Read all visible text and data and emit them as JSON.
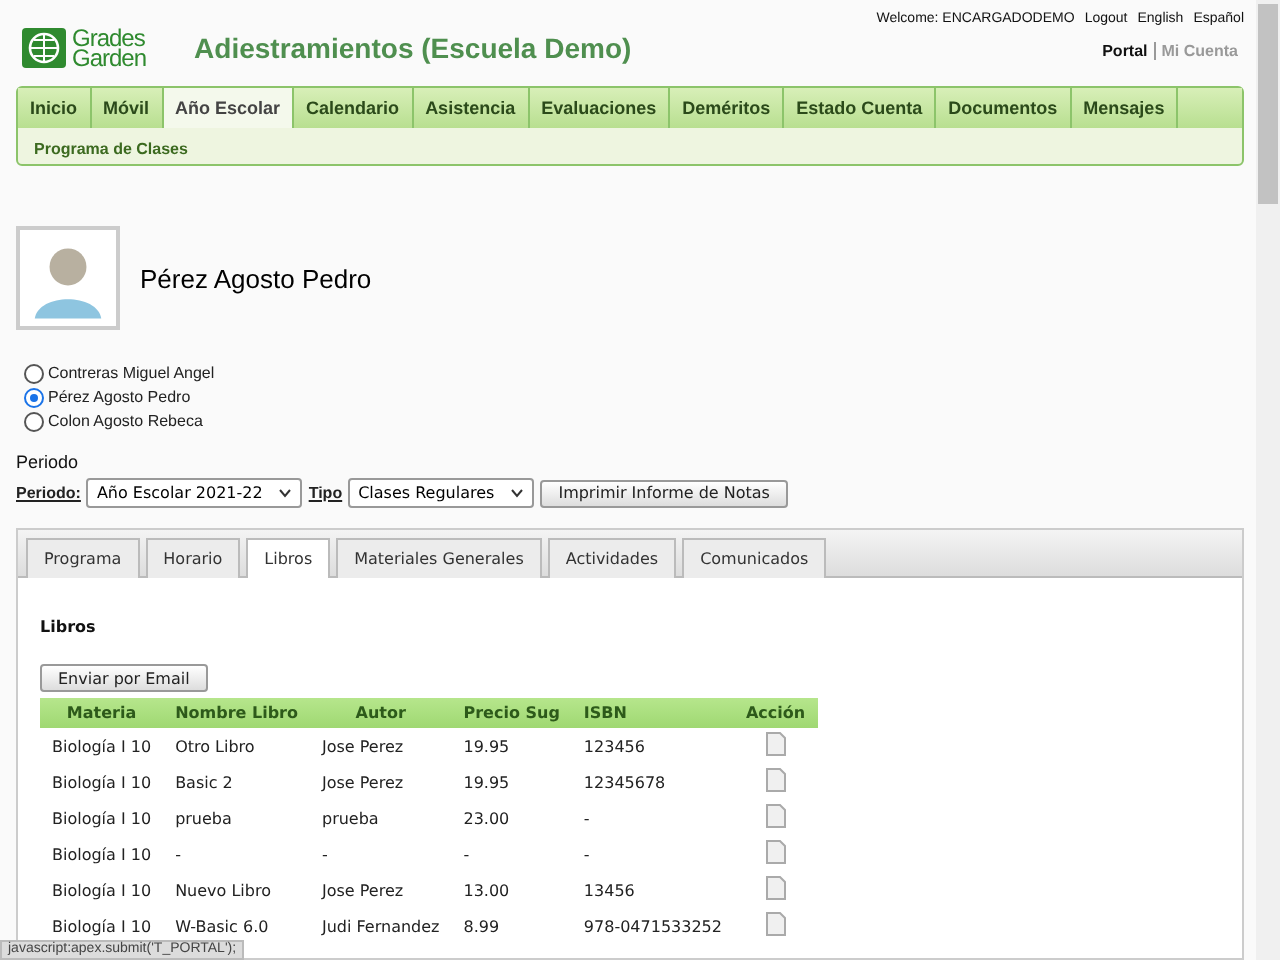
{
  "header": {
    "logo_top": "Grades",
    "logo_bottom": "Garden",
    "title": "Adiestramientos (Escuela Demo)",
    "welcome": "Welcome: ENCARGADODEMO",
    "links": [
      "Logout",
      "English",
      "Español"
    ],
    "portal_links": [
      {
        "label": "Portal",
        "selected": true
      },
      {
        "label": "Mi Cuenta",
        "selected": false
      }
    ]
  },
  "nav": {
    "tabs": [
      {
        "label": "Inicio",
        "selected": false
      },
      {
        "label": "Móvil",
        "selected": false
      },
      {
        "label": "Año Escolar",
        "selected": true
      },
      {
        "label": "Calendario",
        "selected": false
      },
      {
        "label": "Asistencia",
        "selected": false
      },
      {
        "label": "Evaluaciones",
        "selected": false
      },
      {
        "label": "Deméritos",
        "selected": false
      },
      {
        "label": "Estado Cuenta",
        "selected": false
      },
      {
        "label": "Documentos",
        "selected": false
      },
      {
        "label": "Mensajes",
        "selected": false
      }
    ],
    "subnav": [
      "Programa de Clases"
    ]
  },
  "student": {
    "name": "Pérez Agosto Pedro"
  },
  "students": [
    {
      "label": "Contreras Miguel Angel",
      "selected": false
    },
    {
      "label": "Pérez Agosto Pedro",
      "selected": true
    },
    {
      "label": "Colon Agosto Rebeca",
      "selected": false
    }
  ],
  "filters": {
    "heading": "Periodo",
    "period_label": "Periodo:",
    "period_value": "Año Escolar 2021-22",
    "type_label": "Tipo",
    "type_value": "Clases Regulares",
    "print_button": "Imprimir Informe de Notas"
  },
  "tabs": [
    {
      "label": "Programa",
      "selected": false
    },
    {
      "label": "Horario",
      "selected": false
    },
    {
      "label": "Libros",
      "selected": true
    },
    {
      "label": "Materiales Generales",
      "selected": false
    },
    {
      "label": "Actividades",
      "selected": false
    },
    {
      "label": "Comunicados",
      "selected": false
    }
  ],
  "books": {
    "heading": "Libros",
    "email_button": "Enviar por Email",
    "columns": [
      "Materia",
      "Nombre Libro",
      "Autor",
      "Precio Sug",
      "ISBN",
      "Acción"
    ],
    "rows": [
      [
        "Biología I 10",
        "Otro Libro",
        "Jose Perez",
        "19.95",
        "123456"
      ],
      [
        "Biología I 10",
        "Basic 2",
        "Jose Perez",
        "19.95",
        "12345678"
      ],
      [
        "Biología I 10",
        "prueba",
        "prueba",
        "23.00",
        "-"
      ],
      [
        "Biología I 10",
        "-",
        "-",
        "-",
        "-"
      ],
      [
        "Biología I 10",
        "Nuevo Libro",
        "Jose Perez",
        "13.00",
        "13456"
      ],
      [
        "Biología I 10",
        "W-Basic 6.0",
        "Judi Fernandez",
        "8.99",
        "978-0471533252"
      ]
    ]
  },
  "status_bar": "javascript:apex.submit('T_PORTAL');"
}
